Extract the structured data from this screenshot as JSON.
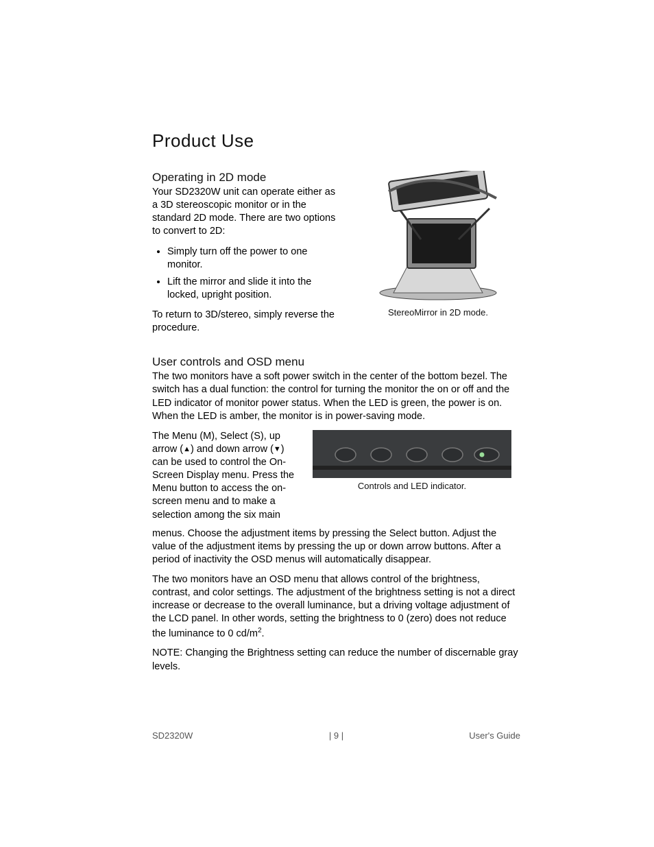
{
  "title": "Product Use",
  "section1": {
    "heading": "Operating in 2D mode",
    "intro": "Your SD2320W unit can operate either as a 3D stereoscopic monitor or in the standard 2D mode.  There are two options to convert to 2D:",
    "bullets": [
      "Simply turn off the power to one monitor.",
      "Lift the mirror and slide it into the locked, upright position."
    ],
    "outro": "To return to 3D/stereo, simply reverse the procedure.",
    "figcaption": "StereoMirror in 2D mode."
  },
  "section2": {
    "heading": "User controls and OSD menu",
    "p1": "The two monitors have a soft power switch in the center of the bottom bezel.  The switch has a dual function:  the control for turning the monitor the on or off and the LED indicator of monitor power status.  When the LED is green, the power is on.  When the LED is amber, the monitor is in power-saving mode.",
    "p2a": "The Menu (M), Select (S), up arrow (",
    "p2b": ") and down arrow (",
    "p2c": ") can be used to control the On-Screen Display menu.  Press the Menu button to access the on-screen menu and to make a selection among the six main",
    "figcaption": "Controls and LED indicator.",
    "p2cont": "menus.  Choose the adjustment items by pressing the Select button.  Adjust the value of the adjustment items by pressing the up or down arrow buttons.  After a period of inactivity the OSD menus will automatically disappear.",
    "p3a": "The two monitors have an OSD menu that allows control of the brightness, contrast, and color settings.  The adjustment of the brightness setting is not a direct increase or decrease to the overall luminance, but a driving voltage adjustment of the LCD panel.  In other words, setting the brightness to 0 (zero) does not reduce the luminance to 0 cd/m",
    "p3b": ".",
    "note": "NOTE: Changing the Brightness setting can reduce the number of discernable gray levels."
  },
  "footer": {
    "left": "SD2320W",
    "center": "| 9 |",
    "right": "User's Guide"
  }
}
